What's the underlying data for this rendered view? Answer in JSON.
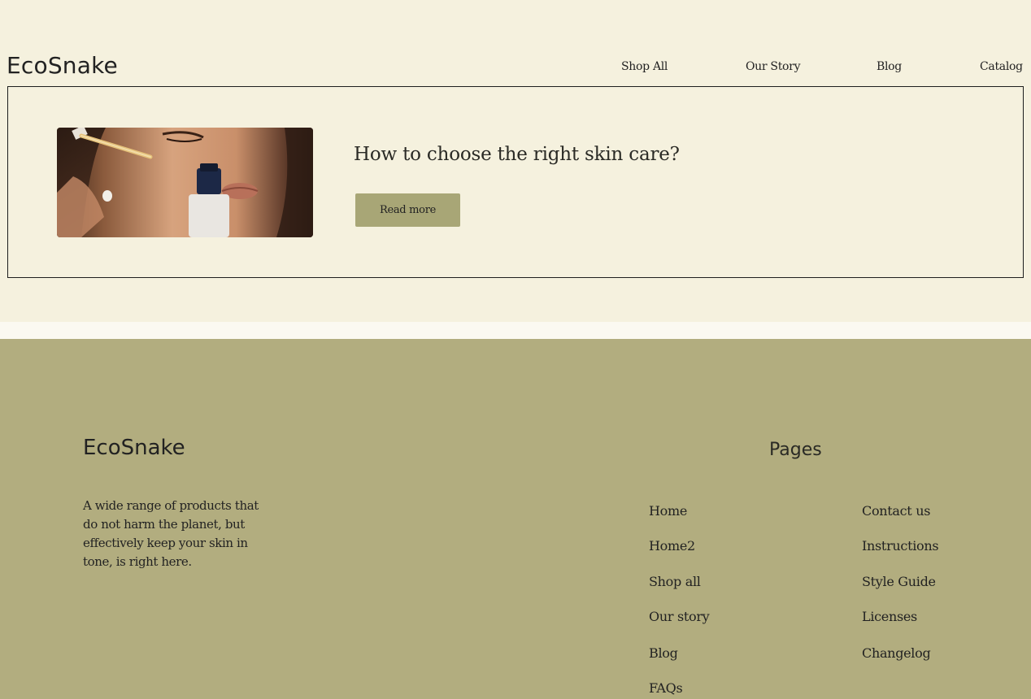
{
  "header": {
    "brand": "EcoSnake",
    "nav": [
      "Shop All",
      "Our Story",
      "Blog",
      "Catalog"
    ]
  },
  "post": {
    "title": "How to choose the right skin care?",
    "button_label": "Read more"
  },
  "footer": {
    "brand": "EcoSnake",
    "description": "A wide range of products that do not harm the planet, but effectively keep your skin in tone, is right here.",
    "pages_heading": "Pages",
    "links_col1": [
      "Home",
      "Home2",
      "Shop all",
      "Our story",
      "Blog",
      "FAQs"
    ],
    "links_col2": [
      "Contact us",
      "Instructions",
      "Style Guide",
      "Licenses",
      "Changelog"
    ]
  },
  "colors": {
    "page_bg": "#f5f1de",
    "footer_bg": "#b2ad7f",
    "button_bg": "#a8a676",
    "text": "#222222"
  }
}
